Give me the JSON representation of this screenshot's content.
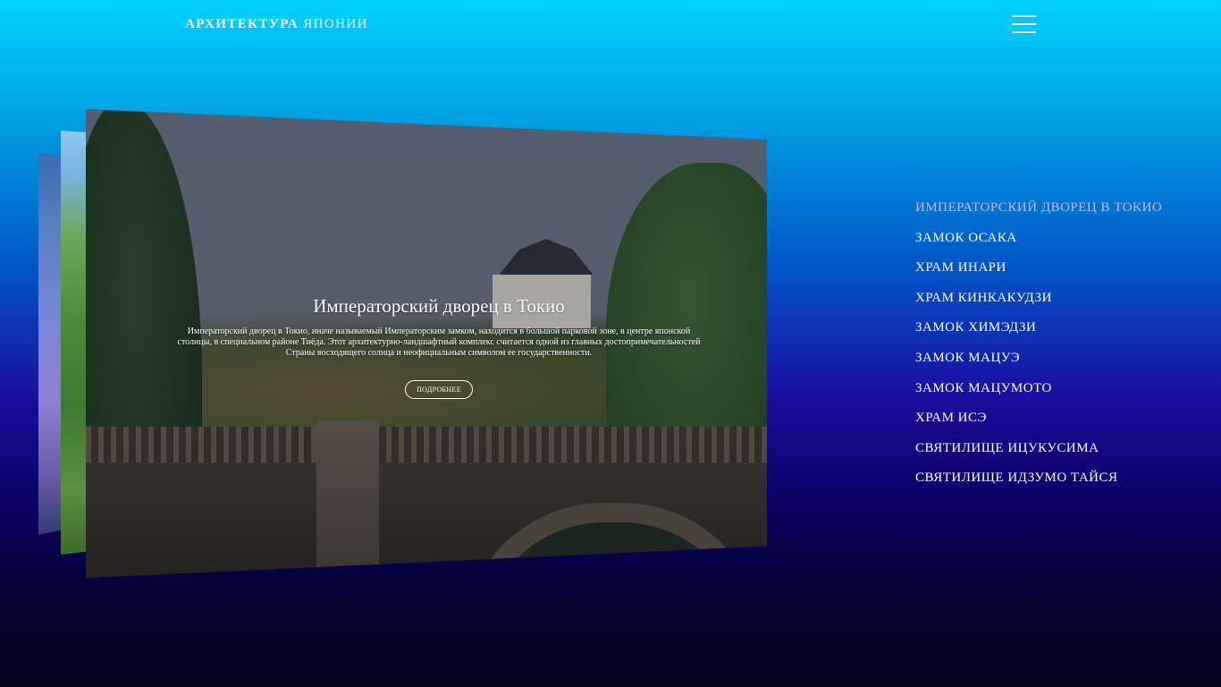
{
  "header": {
    "logo_bold": "АРХИТЕКТУРА",
    "logo_light": "ЯПОНИИ",
    "menu_icon": "hamburger-menu-icon"
  },
  "slide": {
    "title": "Императорский дворец в Токио",
    "text": "Императорский дворец в Токио, иначе называемый Императорским замком, находится в большой парковой зоне, в центре японской столицы, в специальном районе Тиёда. Этот архитектурно-ландшафтный комплекс считается одной из главных достопримечательностей Страны восходящего солнца и неофициальным символом ее государственности.",
    "button_label": "ПОДРОБНЕЕ"
  },
  "nav": {
    "items": [
      {
        "label": "ИМПЕРАТОРСКИЙ ДВОРЕЦ В ТОКИО",
        "active": true
      },
      {
        "label": "ЗАМОК ОСАКА",
        "active": false
      },
      {
        "label": "ХРАМ ИНАРИ",
        "active": false
      },
      {
        "label": "ХРАМ КИНКАКУДЗИ",
        "active": false
      },
      {
        "label": "ЗАМОК ХИМЭДЗИ",
        "active": false
      },
      {
        "label": "ЗАМОК МАЦУЭ",
        "active": false
      },
      {
        "label": "ЗАМОК МАЦУМОТО",
        "active": false
      },
      {
        "label": "ХРАМ ИСЭ",
        "active": false
      },
      {
        "label": "СВЯТИЛИЩЕ ИЦУКУСИМА",
        "active": false
      },
      {
        "label": "СВЯТИЛИЩЕ ИДЗУМО ТАЙСЯ",
        "active": false
      }
    ]
  },
  "colors": {
    "active_nav": "#c9b8ec",
    "text": "#ffffff"
  }
}
